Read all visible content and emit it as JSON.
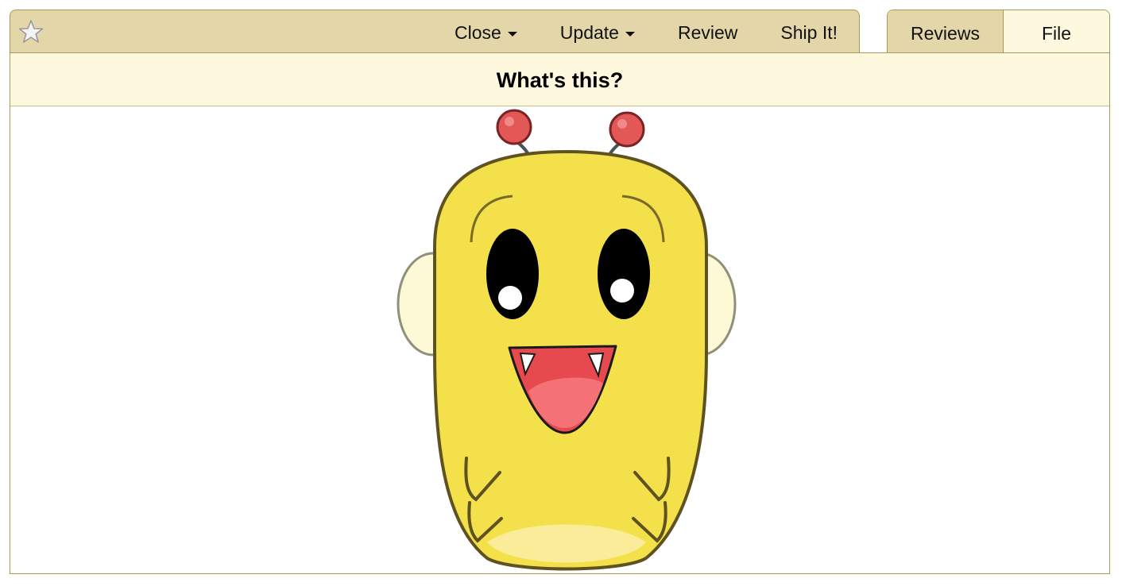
{
  "action_bar": {
    "star_icon": "star-outline-icon",
    "items": [
      {
        "label": "Close",
        "has_dropdown": true
      },
      {
        "label": "Update",
        "has_dropdown": true
      },
      {
        "label": "Review",
        "has_dropdown": false
      },
      {
        "label": "Ship It!",
        "has_dropdown": false
      }
    ]
  },
  "tabs": [
    {
      "label": "Reviews",
      "selected": false
    },
    {
      "label": "File",
      "selected": true
    }
  ],
  "panel": {
    "title": "What's this?",
    "image_icon": "bee-mascot-icon"
  },
  "colors": {
    "bar_bg": "#e3d6a8",
    "border": "#a89a52",
    "header_bg": "#fdf8de",
    "mascot_yellow": "#f4e04a"
  }
}
